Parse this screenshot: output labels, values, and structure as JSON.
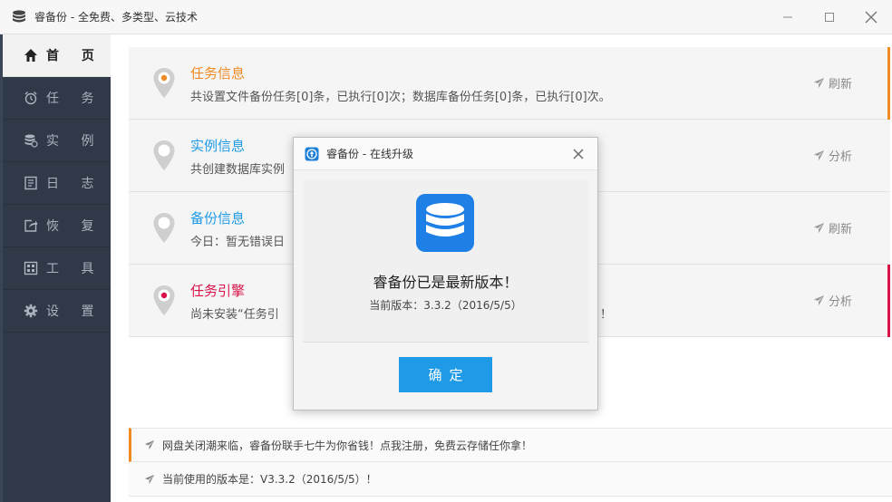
{
  "window": {
    "title": "睿备份 - 全免费、多类型、云技术"
  },
  "sidebar": {
    "items": [
      {
        "label": "首 页",
        "icon": "home-icon"
      },
      {
        "label": "任 务",
        "icon": "alarm-icon"
      },
      {
        "label": "实 例",
        "icon": "database-icon"
      },
      {
        "label": "日 志",
        "icon": "log-icon"
      },
      {
        "label": "恢 复",
        "icon": "restore-icon"
      },
      {
        "label": "工 具",
        "icon": "tools-icon"
      },
      {
        "label": "设 置",
        "icon": "gear-icon"
      }
    ]
  },
  "cards": [
    {
      "title": "任务信息",
      "desc": "共设置文件备份任务[0]条，已执行[0]次；数据库备份任务[0]条，已执行[0]次。",
      "action": "刷新",
      "title_color": "#f08a24",
      "accent": "#f08a24"
    },
    {
      "title": "实例信息",
      "desc": "共创建数据库实例",
      "action": "分析",
      "title_color": "#1e9ae6",
      "accent": ""
    },
    {
      "title": "备份信息",
      "desc": "今日：暂无错误日",
      "action": "刷新",
      "title_color": "#1e9ae6",
      "accent": ""
    },
    {
      "title": "任务引擎",
      "desc": "尚未安装“任务引",
      "desc_tail": "！",
      "action": "分析",
      "title_color": "#d9134a",
      "accent": "#d9134a"
    }
  ],
  "notices": [
    {
      "text": "网盘关闭潮来临，睿备份联手七牛为你省钱！点我注册，免费云存储任你拿！"
    },
    {
      "text": "当前使用的版本是：V3.3.2（2016/5/5）！"
    }
  ],
  "modal": {
    "title": "睿备份 - 在线升级",
    "message": "睿备份已是最新版本！",
    "version": "当前版本：3.3.2（2016/5/5）",
    "ok_label": "确定"
  },
  "colors": {
    "sidebar_bg": "#2f3948",
    "accent_orange": "#f08a24",
    "accent_blue": "#1e9ae6",
    "accent_red": "#d9134a"
  }
}
